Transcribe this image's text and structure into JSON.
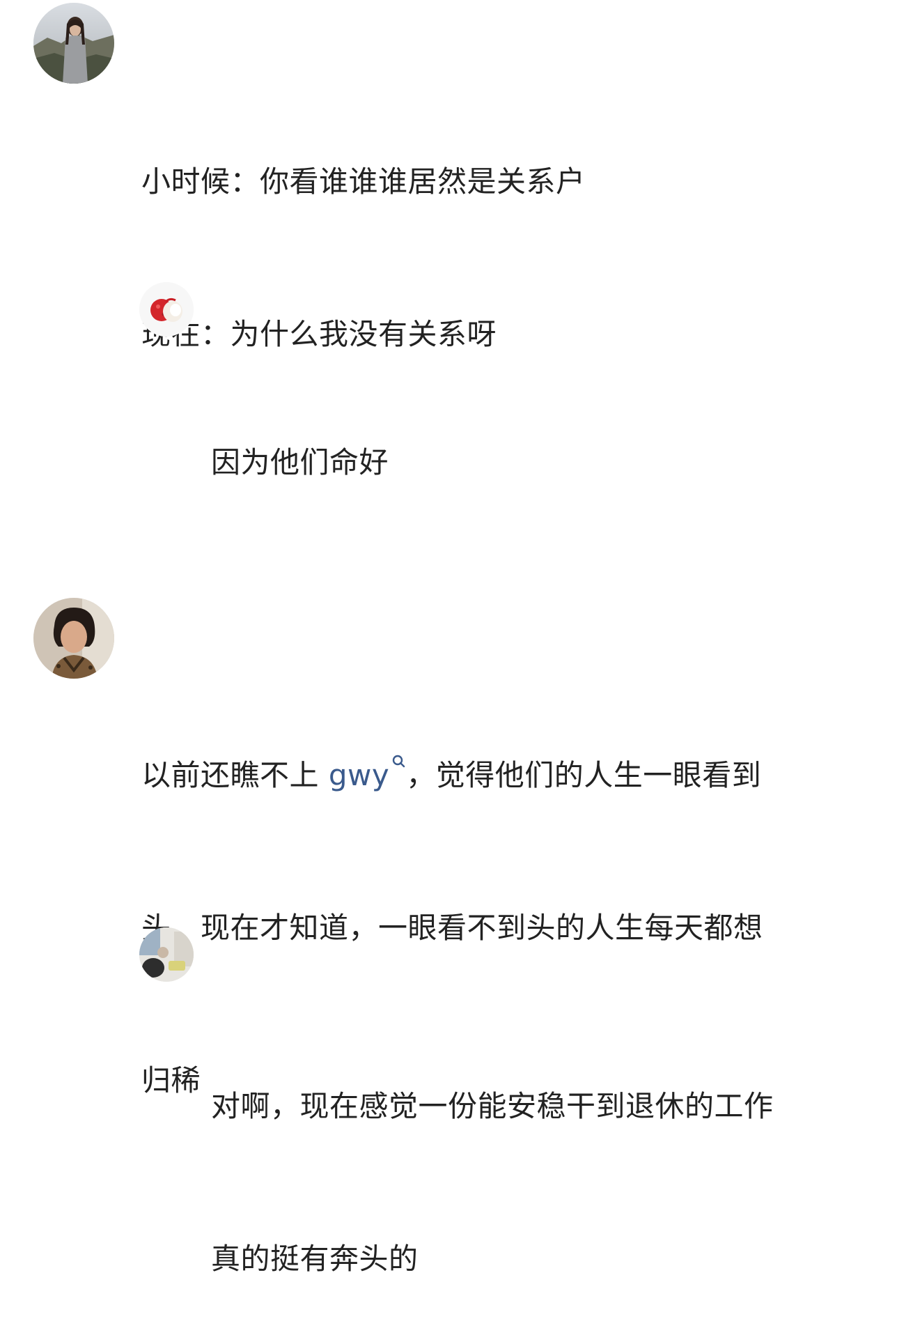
{
  "comments": [
    {
      "avatar_icon": "profile-photo-woman-landscape",
      "lines": [
        "小时候：你看谁谁谁居然是关系户",
        "现在：为什么我没有关系呀"
      ]
    },
    {
      "avatar_icon": "lychee-icon",
      "lines": [
        "因为他们命好"
      ]
    },
    {
      "avatar_icon": "profile-photo-woman-portrait",
      "line1_prefix": "以前还瞧不上 ",
      "line1_link": "gwy",
      "line1_suffix": "，觉得他们的人生一眼看到",
      "line2": "头。现在才知道，一眼看不到头的人生每天都想",
      "line3": "归稀",
      "link_color": "#3a5a8c"
    },
    {
      "avatar_icon": "profile-photo-room-scene",
      "lines": [
        "对啊，现在感觉一份能安稳干到退休的工作",
        "真的挺有奔头的"
      ]
    }
  ]
}
